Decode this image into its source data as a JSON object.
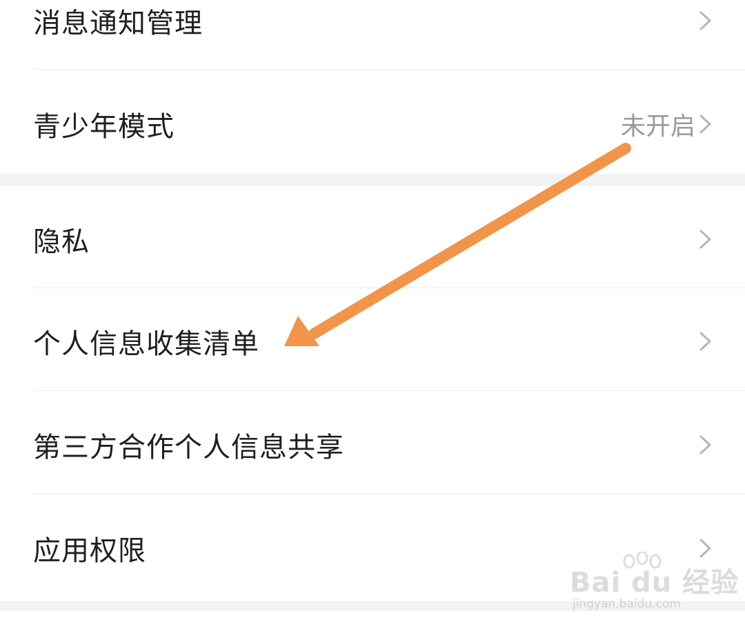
{
  "settings_list": {
    "group_1": [
      {
        "label": "消息通知管理",
        "value": ""
      },
      {
        "label": "青少年模式",
        "value": "未开启"
      }
    ],
    "group_2": [
      {
        "label": "隐私",
        "value": ""
      },
      {
        "label": "个人信息收集清单",
        "value": ""
      },
      {
        "label": "第三方合作个人信息共享",
        "value": ""
      },
      {
        "label": "应用权限",
        "value": ""
      }
    ]
  },
  "annotation": {
    "arrow_color": "#f0954a",
    "points_to": "个人信息收集清单"
  },
  "watermark": {
    "logo_text": "Bai du 经验",
    "url": "jingyan.baidu.com"
  },
  "colors": {
    "background": "#f2f3f5",
    "card": "#ffffff",
    "label_text": "#1f1f1f",
    "value_text": "#9a9a9a",
    "chevron": "#b5b5b5"
  }
}
